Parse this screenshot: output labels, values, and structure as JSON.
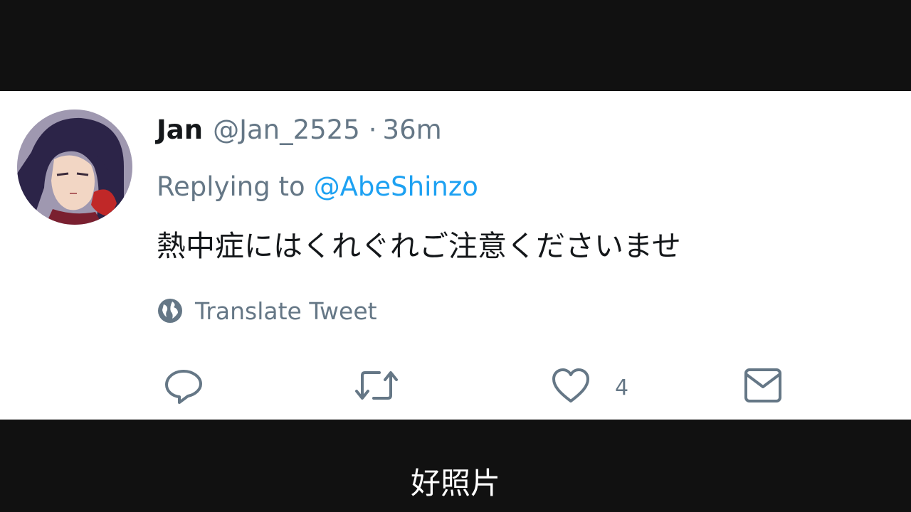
{
  "tweet": {
    "author_name": "Jan",
    "author_handle": "@Jan_2525",
    "separator": "·",
    "time_ago": "36m",
    "reply_prefix": "Replying to",
    "reply_target": "@AbeShinzo",
    "text": "熱中症にはくれぐれご注意くださいませ",
    "translate_label": "Translate Tweet",
    "actions": {
      "reply_icon": "reply-icon",
      "retweet_icon": "retweet-icon",
      "like_icon": "heart-icon",
      "like_count": "4",
      "message_icon": "envelope-icon"
    },
    "colors": {
      "link": "#1da1f2",
      "secondary": "#657786",
      "text": "#14171a"
    }
  },
  "subtitle": "好照片"
}
